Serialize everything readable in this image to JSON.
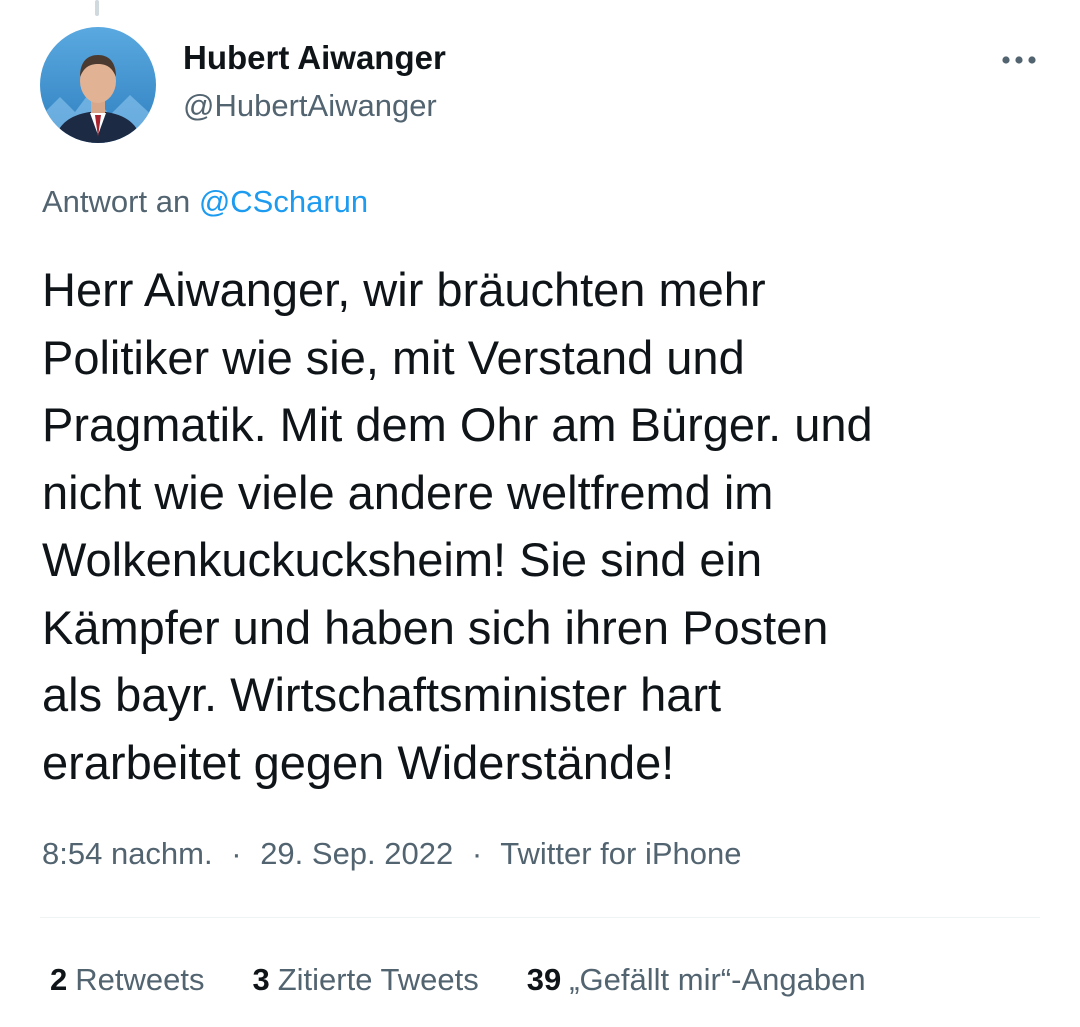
{
  "author": {
    "name": "Hubert Aiwanger",
    "handle": "@HubertAiwanger",
    "avatar_icon": "profile-photo"
  },
  "more_icon": "more-horizontal-icon",
  "reply": {
    "prefix": "Antwort an",
    "mention": "@CScharun"
  },
  "tweet": {
    "text": "Herr Aiwanger, wir bräuchten mehr\nPolitiker wie sie, mit Verstand und\nPragmatik. Mit dem Ohr am Bürger. und\nnicht wie viele andere weltfremd im\nWolkenkuckucksheim! Sie sind ein\nKämpfer und haben sich ihren Posten\nals bayr. Wirtschaftsminister hart\nerarbeitet gegen Widerstände!"
  },
  "meta": {
    "time": "8:54 nachm.",
    "separator": "·",
    "date": "29. Sep. 2022",
    "source": "Twitter for iPhone"
  },
  "stats": {
    "retweets": {
      "count": "2",
      "label": "Retweets"
    },
    "quotes": {
      "count": "3",
      "label": "Zitierte Tweets"
    },
    "likes": {
      "count": "39",
      "label": "„Gefällt mir“-Angaben"
    }
  },
  "colors": {
    "text": "#0f1419",
    "secondary": "#536471",
    "link": "#1d9bf0",
    "divider": "#eff3f4"
  }
}
